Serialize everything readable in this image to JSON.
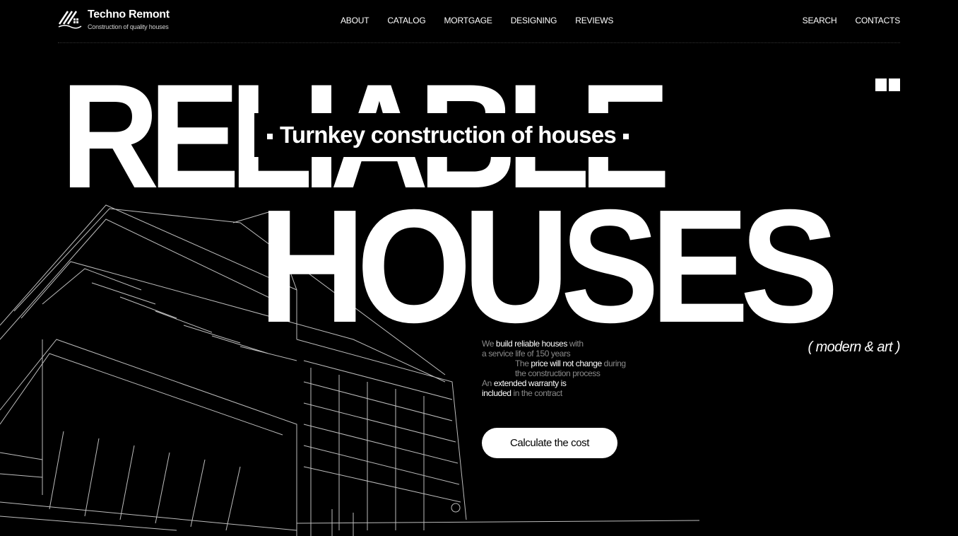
{
  "brand": {
    "name": "Techno Remont",
    "tagline": "Construction of quality houses"
  },
  "nav": {
    "items": [
      "ABOUT",
      "CATALOG",
      "MORTGAGE",
      "DESIGNING",
      "REVIEWS"
    ]
  },
  "nav_right": {
    "search": "SEARCH",
    "contacts": "CONTACTS"
  },
  "hero": {
    "headline_top": "RELIABLE",
    "headline_bottom": "HOUSES",
    "subtitle": "Turnkey construction of houses",
    "style_note": "( modern & art )"
  },
  "features": {
    "f1_pre": "We ",
    "f1_bold": "build reliable houses",
    "f1_post": " with",
    "f1_line2": "a service life of 150 years",
    "f2_pre": "The ",
    "f2_bold": "price will not change",
    "f2_post": " during",
    "f2_line2": "the construction process",
    "f3_pre": "An ",
    "f3_bold": "extended warranty is",
    "f3_bold2": "included",
    "f3_post": " in the contract"
  },
  "cta": {
    "label": "Calculate the cost"
  },
  "icons": {
    "logo": "house-logo-icon",
    "grid": "grid-icon"
  }
}
